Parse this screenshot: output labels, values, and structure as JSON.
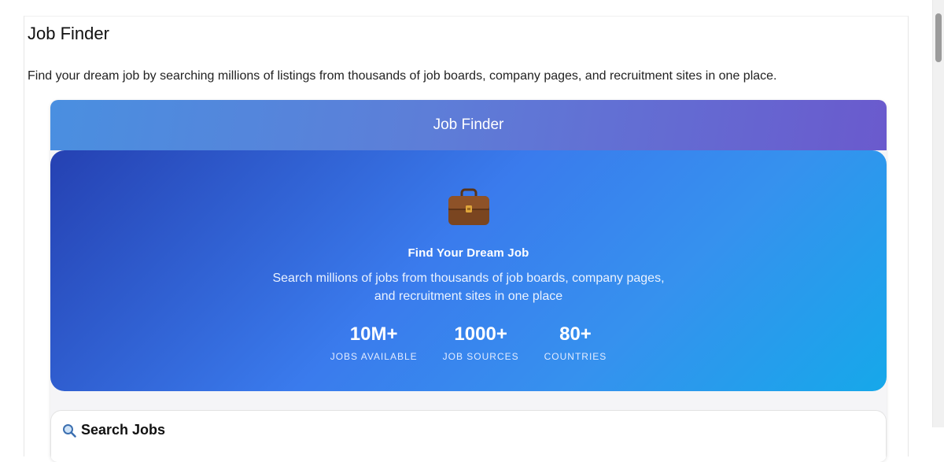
{
  "page": {
    "title": "Job Finder",
    "description": "Find your dream job by searching millions of listings from thousands of job boards, company pages, and recruitment sites in one place."
  },
  "app": {
    "header_title": "Job Finder",
    "hero": {
      "icon": "briefcase-icon",
      "title": "Find Your Dream Job",
      "subtitle": "Search millions of jobs from thousands of job boards, company pages, and recruitment sites in one place",
      "stats": [
        {
          "value": "10M+",
          "label": "JOBS AVAILABLE"
        },
        {
          "value": "1000+",
          "label": "JOB SOURCES"
        },
        {
          "value": "80+",
          "label": "COUNTRIES"
        }
      ]
    },
    "search": {
      "icon": "magnifier-icon",
      "title": "Search Jobs"
    }
  },
  "colors": {
    "header_gradient_start": "#4a8fe0",
    "header_gradient_end": "#6a5acd",
    "hero_gradient_start": "#2541b2",
    "hero_gradient_end": "#16a8ea"
  }
}
